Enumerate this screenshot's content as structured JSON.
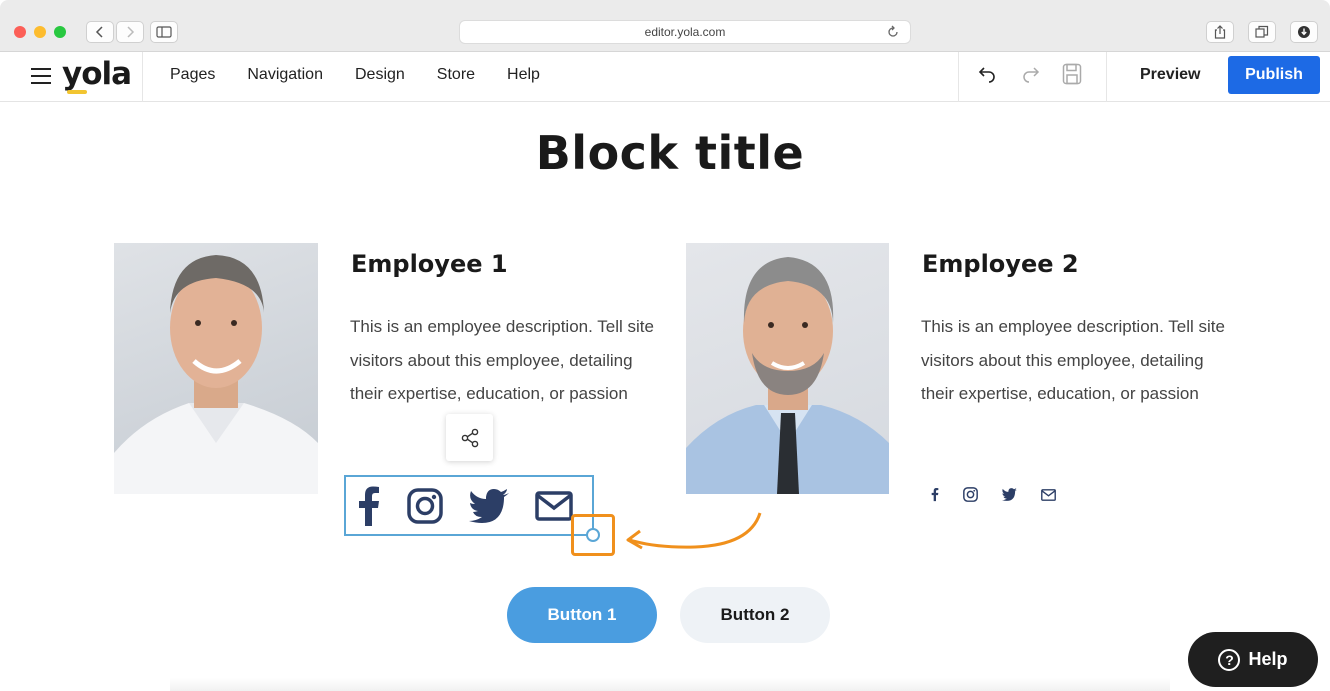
{
  "browser": {
    "url": "editor.yola.com",
    "traffic_lights": [
      "#fc5f57",
      "#fdbc2e",
      "#28c840"
    ]
  },
  "app": {
    "logo": "yola",
    "menu": [
      "Pages",
      "Navigation",
      "Design",
      "Store",
      "Help"
    ],
    "preview_label": "Preview",
    "publish_label": "Publish",
    "publish_color": "#1d6ae5"
  },
  "page": {
    "block_title": "Block title",
    "employees": [
      {
        "name": "Employee 1",
        "description": "This is an employee description. Tell site visitors about this employee, detailing their expertise, education, or passion",
        "social_icons": [
          "facebook-icon",
          "instagram-icon",
          "twitter-icon",
          "mail-icon"
        ]
      },
      {
        "name": "Employee 2",
        "description": "This is an employee description. Tell site visitors about this employee, detailing their expertise, education, or passion",
        "social_icons": [
          "facebook-icon",
          "instagram-icon",
          "twitter-icon",
          "mail-icon"
        ]
      }
    ],
    "buttons": [
      "Button 1",
      "Button 2"
    ],
    "button1_color": "#4a9de0",
    "help_label": "Help",
    "accent_highlight": "#f0901c",
    "selection_color": "#5aa6d6"
  }
}
